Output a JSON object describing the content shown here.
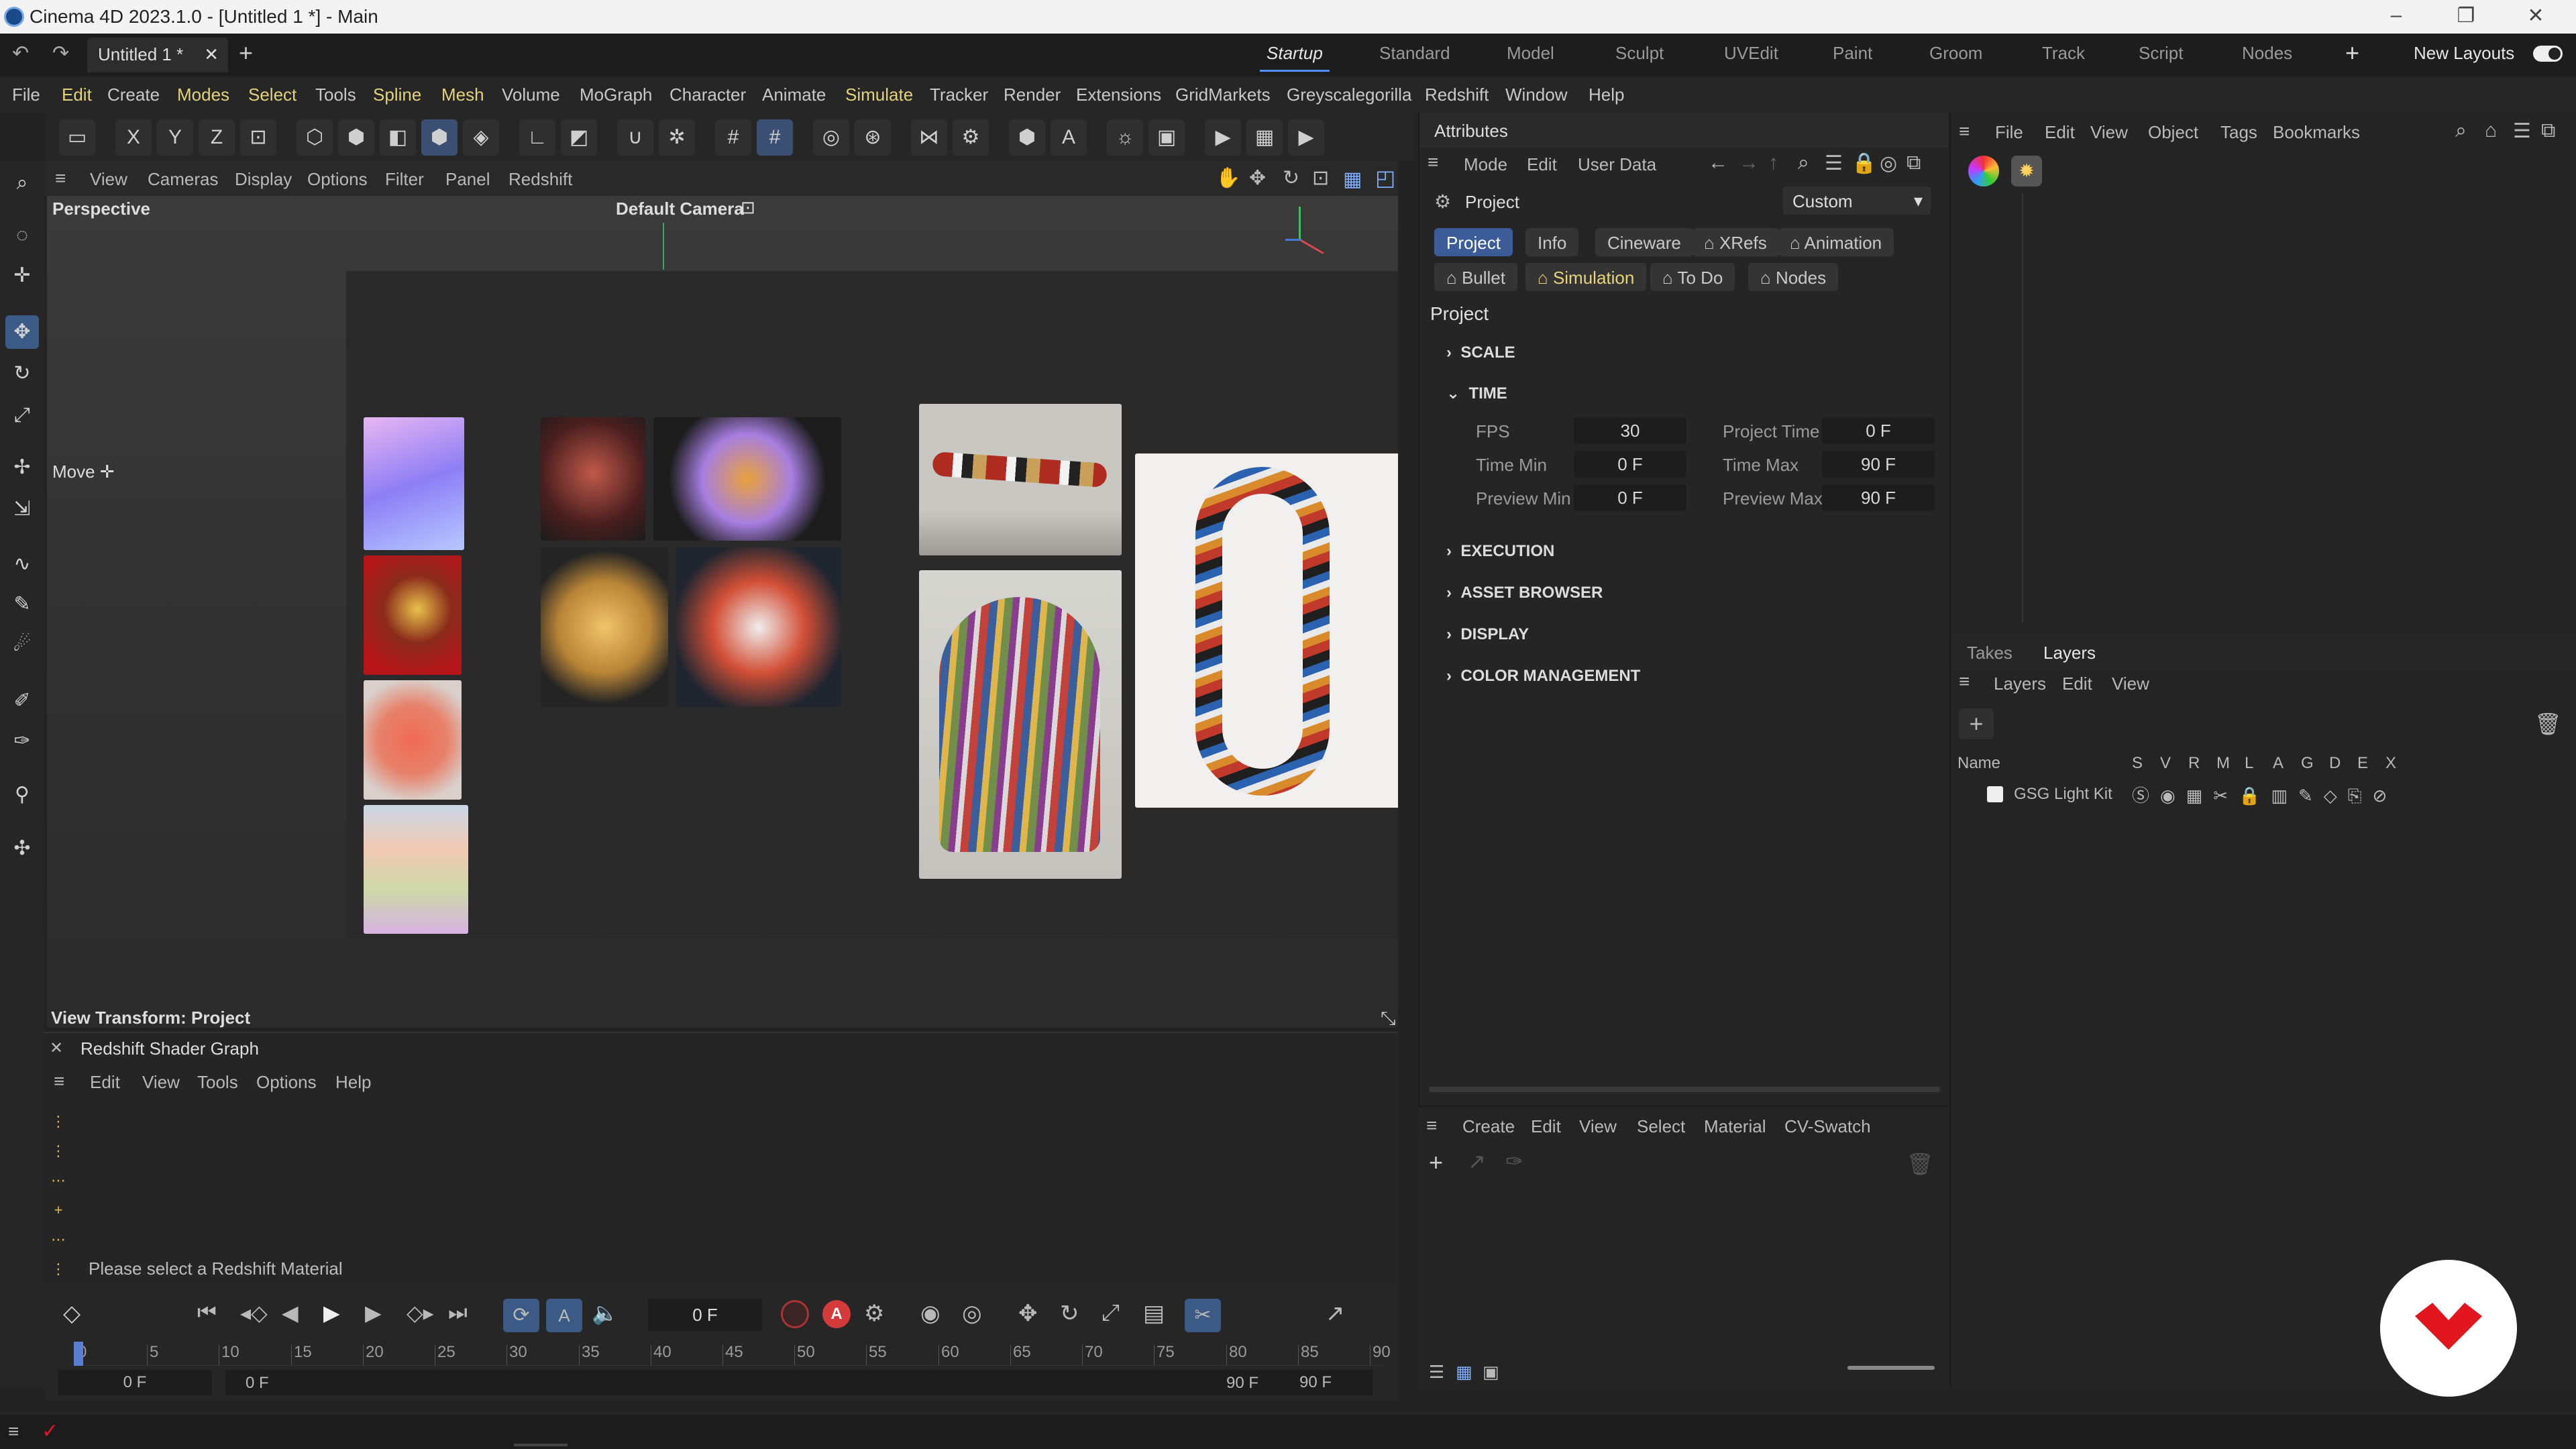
{
  "title": "Cinema 4D 2023.1.0 - [Untitled 1 *] - Main",
  "doc_tab": "Untitled 1 *",
  "layout_tabs": [
    "Startup",
    "Standard",
    "Model",
    "Sculpt",
    "UVEdit",
    "Paint",
    "Groom",
    "Track",
    "Script",
    "Nodes"
  ],
  "new_layouts": "New Layouts",
  "menu": [
    "File",
    "Edit",
    "Create",
    "Modes",
    "Select",
    "Tools",
    "Spline",
    "Mesh",
    "Volume",
    "MoGraph",
    "Character",
    "Animate",
    "Simulate",
    "Tracker",
    "Render",
    "Extensions",
    "GridMarkets",
    "Greyscalegorilla",
    "Redshift",
    "Window",
    "Help"
  ],
  "viewport": {
    "menu": [
      "View",
      "Cameras",
      "Display",
      "Options",
      "Filter",
      "Panel",
      "Redshift"
    ],
    "perspective": "Perspective",
    "camera": "Default Camera",
    "move_label": "Move",
    "view_transform": "View Transform: Project"
  },
  "shader_graph": {
    "title": "Redshift Shader Graph",
    "menu": [
      "Edit",
      "View",
      "Tools",
      "Options",
      "Help"
    ],
    "message": "Please select a Redshift Material"
  },
  "timeline": {
    "current_frame": "0 F",
    "ticks": [
      "0",
      "5",
      "10",
      "15",
      "20",
      "25",
      "30",
      "35",
      "40",
      "45",
      "50",
      "55",
      "60",
      "65",
      "70",
      "75",
      "80",
      "85",
      "90"
    ],
    "start": "0 F",
    "range_start": "0 F",
    "range_end": "90 F",
    "end": "90 F",
    "playhead_fraction": 0
  },
  "attributes": {
    "title": "Attributes",
    "menu": [
      "Mode",
      "Edit",
      "User Data"
    ],
    "object": "Project",
    "preset": "Custom",
    "tabs_row1": [
      "Project",
      "Info",
      "Cineware",
      "XRefs",
      "Animation"
    ],
    "tabs_row2": [
      "Bullet",
      "Simulation",
      "To Do",
      "Nodes"
    ],
    "section_title": "Project",
    "sections": [
      "SCALE",
      "TIME",
      "EXECUTION",
      "ASSET BROWSER",
      "DISPLAY",
      "COLOR MANAGEMENT"
    ],
    "time": {
      "fps_label": "FPS",
      "fps": "30",
      "project_time_label": "Project Time",
      "project_time": "0 F",
      "time_min_label": "Time Min",
      "time_min": "0 F",
      "time_max_label": "Time Max",
      "time_max": "90 F",
      "preview_min_label": "Preview Min",
      "preview_min": "0 F",
      "preview_max_label": "Preview Max",
      "preview_max": "90 F"
    }
  },
  "objects_menu": [
    "File",
    "Edit",
    "View",
    "Object",
    "Tags",
    "Bookmarks"
  ],
  "layers": {
    "tabs": [
      "Takes",
      "Layers"
    ],
    "menu": [
      "Layers",
      "Edit",
      "View"
    ],
    "columns": [
      "Name",
      "S",
      "V",
      "R",
      "M",
      "L",
      "A",
      "G",
      "D",
      "E",
      "X"
    ],
    "items": [
      {
        "name": "GSG Light Kit"
      }
    ]
  },
  "material_menu": [
    "Create",
    "Edit",
    "View",
    "Select",
    "Material",
    "CV-Swatch"
  ],
  "colors": {
    "accent": "#4a90ff",
    "brand": "#e2141e"
  }
}
